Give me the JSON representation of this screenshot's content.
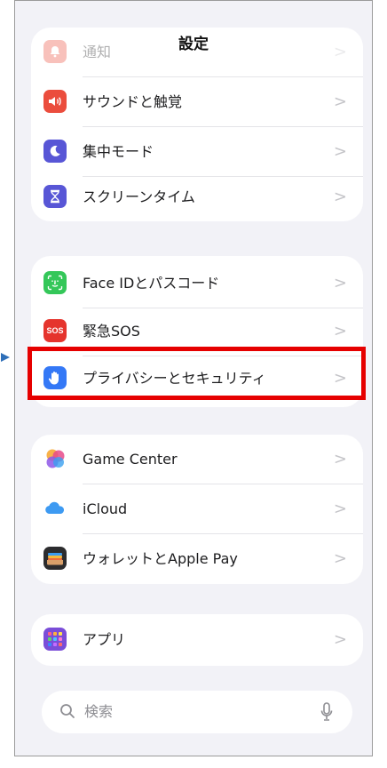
{
  "nav": {
    "title": "設定"
  },
  "groups": {
    "g1": [
      {
        "label": "通知",
        "icon": "bell-icon",
        "color": "#eb4d3d"
      },
      {
        "label": "サウンドと触覚",
        "icon": "speaker-icon",
        "color": "#eb4d3d"
      },
      {
        "label": "集中モード",
        "icon": "moon-icon",
        "color": "#5856d6"
      },
      {
        "label": "スクリーンタイム",
        "icon": "hourglass-icon",
        "color": "#5856d6"
      }
    ],
    "g2": [
      {
        "label": "Face IDとパスコード",
        "icon": "face-id-icon",
        "color": "#34c759"
      },
      {
        "label": "緊急SOS",
        "icon": "sos-icon",
        "icon_text": "SOS",
        "color": "#e5342d"
      },
      {
        "label": "プライバシーとセキュリティ",
        "icon": "hand-icon",
        "color": "#3478f6"
      }
    ],
    "g3": [
      {
        "label": "Game Center",
        "icon": "game-center-icon"
      },
      {
        "label": "iCloud",
        "icon": "cloud-icon",
        "color": "#3d9af2"
      },
      {
        "label": "ウォレットとApple Pay",
        "icon": "wallet-icon",
        "color": "#2c2c2e"
      }
    ],
    "g4": [
      {
        "label": "アプリ",
        "icon": "apps-grid-icon",
        "color": "#7a4dd8"
      }
    ]
  },
  "search": {
    "placeholder": "検索"
  },
  "annotation": {
    "highlight_color": "#e60000",
    "arrow_color": "#2f6fb8"
  }
}
